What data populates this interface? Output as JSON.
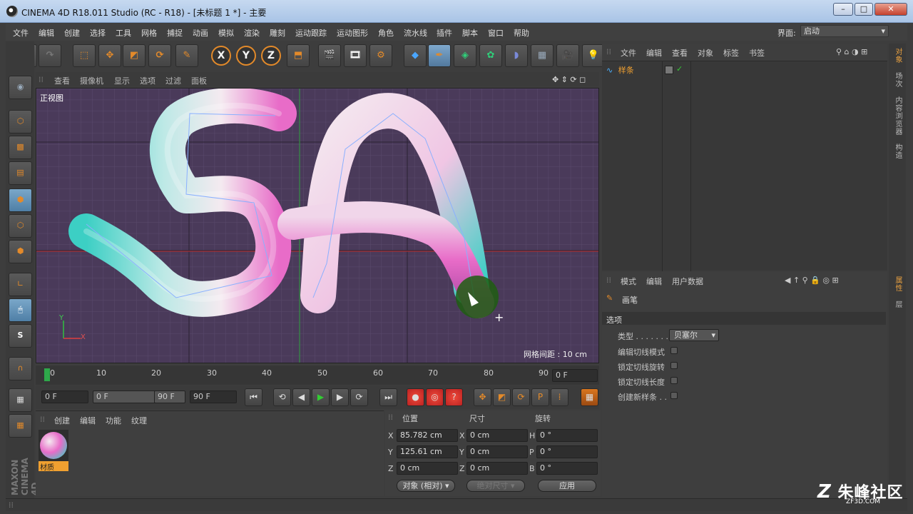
{
  "window": {
    "title": "CINEMA 4D R18.011 Studio (RC - R18) - [未标题 1 *] - 主要"
  },
  "menu": [
    "文件",
    "编辑",
    "创建",
    "选择",
    "工具",
    "网格",
    "捕捉",
    "动画",
    "模拟",
    "渲染",
    "雕刻",
    "运动跟踪",
    "运动图形",
    "角色",
    "流水线",
    "插件",
    "脚本",
    "窗口",
    "帮助"
  ],
  "interface": {
    "label": "界面:",
    "value": "启动"
  },
  "toolbar": {
    "axes": [
      "X",
      "Y",
      "Z"
    ]
  },
  "viewport": {
    "menu": [
      "查看",
      "摄像机",
      "显示",
      "选项",
      "过滤",
      "面板"
    ],
    "label": "正视图",
    "grid_spacing": "网格间距 : 10 cm",
    "axis_y": "Y",
    "axis_x": "X"
  },
  "timeline": {
    "ticks": [
      "0",
      "10",
      "20",
      "30",
      "40",
      "50",
      "60",
      "70",
      "80",
      "90"
    ],
    "current_frame": "0 F"
  },
  "transport": {
    "start": "0 F",
    "range_start": "0 F",
    "range_end": "90 F",
    "end": "90 F"
  },
  "materials": {
    "menu": [
      "创建",
      "编辑",
      "功能",
      "纹理"
    ],
    "item": "材质"
  },
  "coords": {
    "headers": [
      "位置",
      "尺寸",
      "旋转"
    ],
    "rows": [
      {
        "a": "X",
        "pos": "85.782 cm",
        "b": "X",
        "size": "0 cm",
        "c": "H",
        "rot": "0 °"
      },
      {
        "a": "Y",
        "pos": "125.61 cm",
        "b": "Y",
        "size": "0 cm",
        "c": "P",
        "rot": "0 °"
      },
      {
        "a": "Z",
        "pos": "0 cm",
        "b": "Z",
        "size": "0 cm",
        "c": "B",
        "rot": "0 °"
      }
    ],
    "mode": "对象 (相对)",
    "size_mode": "绝对尺寸",
    "apply": "应用"
  },
  "object_manager": {
    "menu": [
      "文件",
      "编辑",
      "查看",
      "对象",
      "标签",
      "书签"
    ],
    "objects": [
      {
        "name": "样条"
      }
    ]
  },
  "attribute_manager": {
    "menu": [
      "模式",
      "编辑",
      "用户数据"
    ],
    "tool": "画笔",
    "section": "选项",
    "type_label": "类型 . . . . . . .",
    "type_value": "贝塞尔",
    "options": [
      "编辑切线模式",
      "锁定切线旋转",
      "锁定切线长度",
      "创建新样条 . ."
    ]
  },
  "right_tabs": [
    "对象",
    "场次",
    "内容浏览器",
    "构造",
    "属性",
    "层"
  ],
  "watermark": {
    "text": "朱峰社区",
    "sub": "ZF3D.COM"
  },
  "colors": {
    "accent": "#e38a2a",
    "viewport_bg": "#4a3a5a",
    "tube_cyan": "#3ccfc4",
    "tube_pink": "#e86cc8",
    "tube_white": "#f4eaf0"
  }
}
